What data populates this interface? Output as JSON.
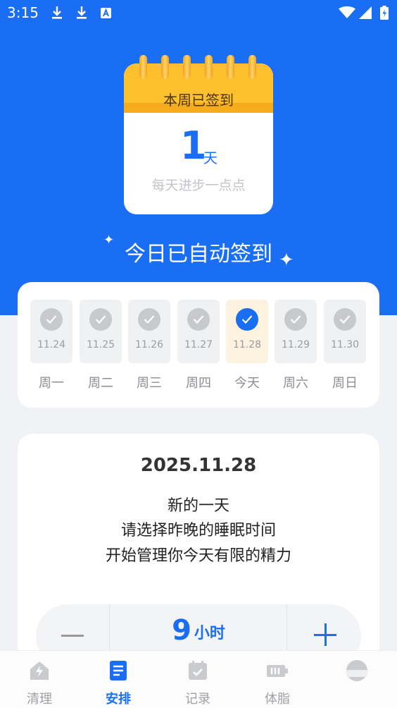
{
  "status_bar": {
    "time": "3:15",
    "icons": [
      "download-icon",
      "download-icon",
      "a-icon",
      "wifi-icon",
      "signal-icon",
      "battery-icon"
    ]
  },
  "calendar": {
    "header": "本周已签到",
    "days": "1",
    "unit": "天",
    "subtitle": "每天进步一点点"
  },
  "auto_sign_text": "今日已自动签到",
  "week": [
    {
      "date": "11.24",
      "label": "周一",
      "checked": true,
      "today": false
    },
    {
      "date": "11.25",
      "label": "周二",
      "checked": true,
      "today": false
    },
    {
      "date": "11.26",
      "label": "周三",
      "checked": true,
      "today": false
    },
    {
      "date": "11.27",
      "label": "周四",
      "checked": true,
      "today": false
    },
    {
      "date": "11.28",
      "label": "今天",
      "checked": true,
      "today": true
    },
    {
      "date": "11.29",
      "label": "周六",
      "checked": true,
      "today": false
    },
    {
      "date": "11.30",
      "label": "周日",
      "checked": true,
      "today": false
    }
  ],
  "info": {
    "date": "2025.11.28",
    "line1": "新的一天",
    "line2": "请选择昨晚的睡眠时间",
    "line3": "开始管理你今天有限的精力"
  },
  "sleep_stepper": {
    "value": "9",
    "unit": "小时"
  },
  "nav": {
    "items": [
      {
        "label": "清理",
        "icon": "clean-icon",
        "active": false
      },
      {
        "label": "安排",
        "icon": "schedule-icon",
        "active": true
      },
      {
        "label": "记录",
        "icon": "record-icon",
        "active": false
      },
      {
        "label": "体脂",
        "icon": "body-fat-icon",
        "active": false
      },
      {
        "label": "",
        "icon": "profile-icon",
        "active": false
      }
    ]
  },
  "colors": {
    "brand_blue": "#1a6ef3",
    "calendar_yellow": "#ffc02e"
  }
}
